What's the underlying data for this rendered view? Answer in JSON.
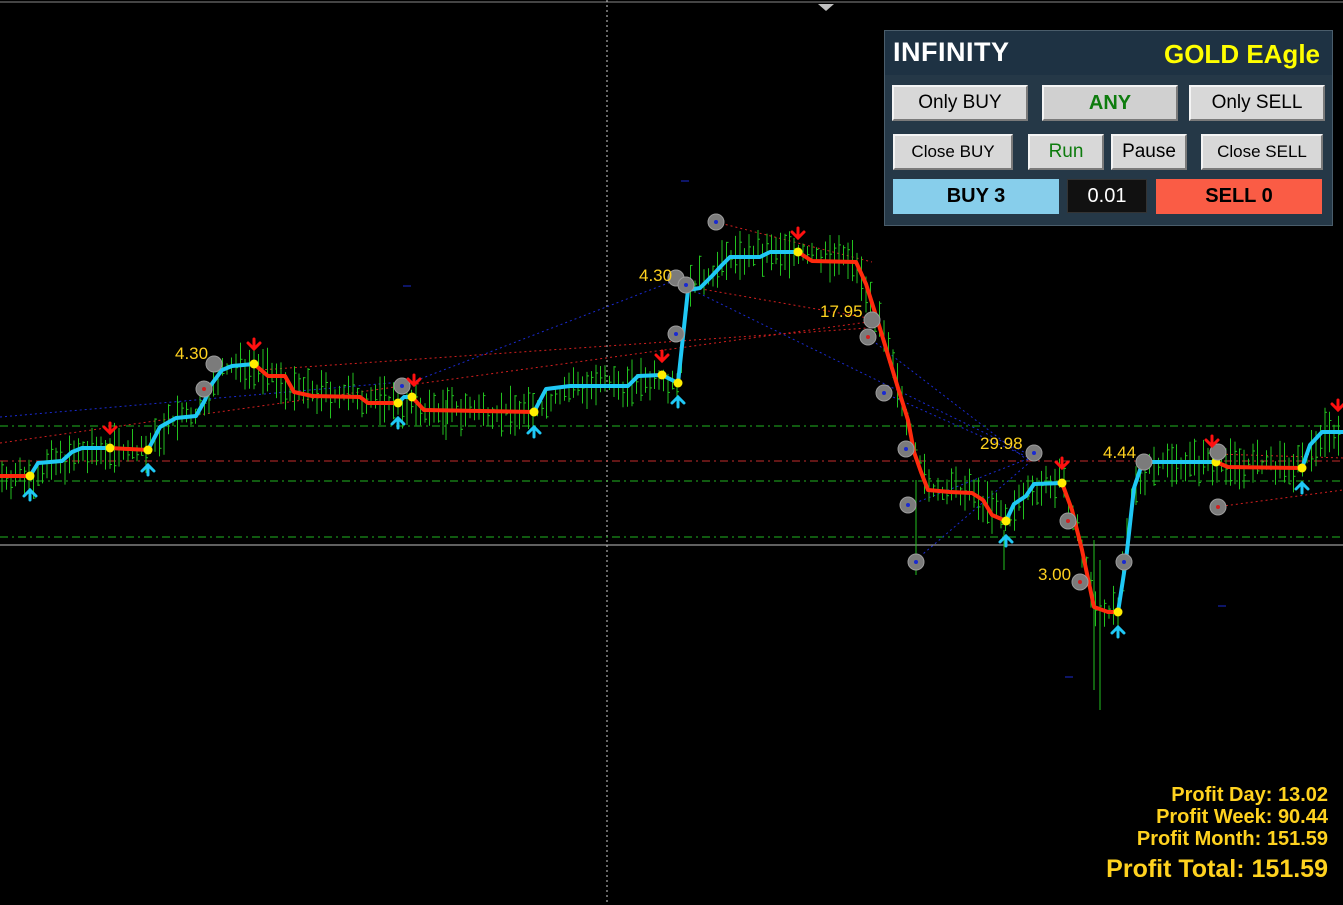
{
  "panel": {
    "title": "INFINITY",
    "subtitle": "GOLD EAgle",
    "buttons": {
      "only_buy": "Only BUY",
      "any": "ANY",
      "only_sell": "Only SELL",
      "close_buy": "Close BUY",
      "run": "Run",
      "pause": "Pause",
      "close_sell": "Close SELL",
      "buy": "BUY 3",
      "sell": "SELL 0"
    },
    "lot_value": "0.01"
  },
  "chart_labels": [
    "4.30",
    "4.30",
    "17.95",
    "29.98",
    "4.44",
    "3.00"
  ],
  "stats": {
    "day": "Profit Day: 13.02",
    "week": "Profit Week: 90.44",
    "month": "Profit Month: 151.59",
    "total": "Profit Total: 151.59"
  },
  "colors": {
    "uptrend": "#1fc8f5",
    "downtrend": "#ff2a0d",
    "candles": "#22c11f",
    "label": "#ffd21f",
    "buy_button": "#87ceeb",
    "sell_button": "#fa5c45"
  }
}
